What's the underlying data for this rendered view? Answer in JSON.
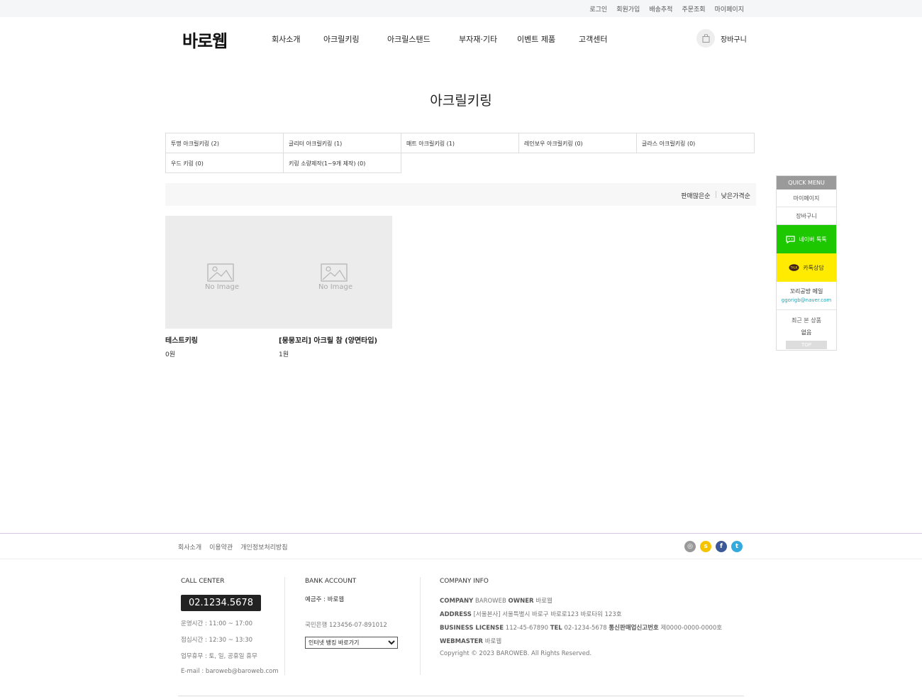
{
  "top_links": [
    "로그인",
    "회원가입",
    "배송추적",
    "주문조회",
    "마이페이지"
  ],
  "logo": "바로웹",
  "nav": [
    "회사소개",
    "아크릴키링",
    "아크릴스탠드",
    "부자재·기타",
    "이벤트 제품",
    "고객센터"
  ],
  "cart": {
    "label": "장바구니",
    "icon": "shopping-bag-icon"
  },
  "page_title": "아크릴키링",
  "categories": [
    "투명 아크릴키링 (2)",
    "글리터 아크릴키링 (1)",
    "매트 아크릴키링 (1)",
    "레인보우 아크릴키링 (0)",
    "글라스 아크릴키링 (0)",
    "우드 키링 (0)",
    "키링 소량제작(1~9개 제작) (0)"
  ],
  "sort_options": [
    "판매많은순",
    "낮은가격순"
  ],
  "products": [
    {
      "name": "테스트키링",
      "price": "0원",
      "image_text": "No Image"
    },
    {
      "name": "[뭉뭉꼬리] 아크릴 참 (양면타입)",
      "price": "1원",
      "image_text": "No Image"
    }
  ],
  "quick_menu": {
    "title": "QUICK MENU",
    "items": [
      "마이페이지",
      "장바구니"
    ],
    "naver": "네이버 톡톡",
    "kakao": "카톡상담",
    "kakao_badge": "TALK",
    "mail_title": "꼬리공방 메일",
    "mail": "ggorigb@naver.com",
    "recent_title": "최근 본 상품",
    "recent_empty": "없음",
    "top": "TOP"
  },
  "footer_links": [
    "회사소개",
    "이용약관",
    "개인정보처리방침"
  ],
  "sns": [
    {
      "name": "instagram-icon",
      "glyph": "◎",
      "color": "#999999"
    },
    {
      "name": "kakaostory-icon",
      "glyph": "s",
      "color": "#f6c300"
    },
    {
      "name": "facebook-icon",
      "glyph": "f",
      "color": "#3b5998"
    },
    {
      "name": "twitter-icon",
      "glyph": "t",
      "color": "#33aadd"
    }
  ],
  "call_center": {
    "title": "CALL CENTER",
    "tel": "02.1234.5678",
    "lines": [
      "운영시간 : 11:00 ~ 17:00",
      "점심시간 : 12:30 ~ 13:30",
      "업무휴무 : 토, 일, 공휴일 휴무",
      "E-mail : baroweb@baroweb.com"
    ]
  },
  "bank": {
    "title": "BANK ACCOUNT",
    "owner": "예금주 : 바로웹",
    "account": "국민은행 123456-07-891012",
    "select": "인터넷 뱅킹 바로가기"
  },
  "company": {
    "title": "COMPANY INFO",
    "company_label": "COMPANY",
    "company_value": "BAROWEB",
    "owner_label": "OWNER",
    "owner_value": "바로웹",
    "address_label": "ADDRESS",
    "address_value": "[서울본사] 서울특별시 바로구 바로로123 바로타워 123호",
    "license_label": "BUSINESS LICENSE",
    "license_value": "112-45-67890",
    "tel_label": "TEL",
    "tel_value": "02-1234-5678",
    "mail_order_label": "통신판매업신고번호",
    "mail_order_value": "제0000-0000-0000호",
    "webmaster_label": "WEBMASTER",
    "webmaster_value": "바로웹",
    "copyright": "Copyright © 2023 BAROWEB. All Rights Reserved."
  },
  "colors": {
    "naver": "#1ec800",
    "kakao": "#ffeb00",
    "mail": "#1aa6b7"
  }
}
